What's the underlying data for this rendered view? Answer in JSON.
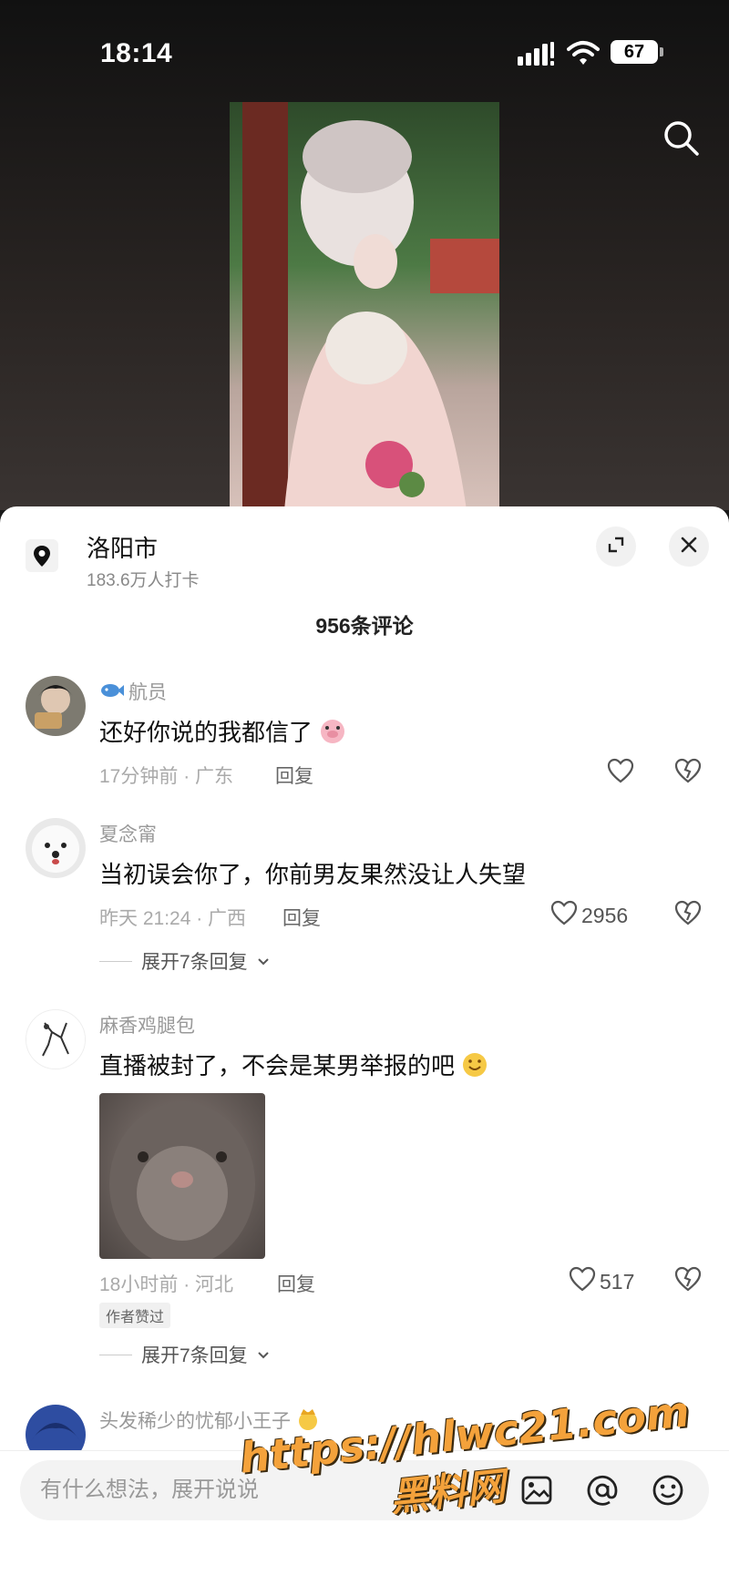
{
  "status_bar": {
    "time": "18:14",
    "battery": "67"
  },
  "video": {
    "search_icon": "search-icon"
  },
  "location": {
    "title": "洛阳市",
    "subtitle": "183.6万人打卡"
  },
  "comments_header": {
    "count_label": "956条评论"
  },
  "comments": [
    {
      "name": "航员",
      "text": "还好你说的我都信了",
      "time_location": "17分钟前 · 广东",
      "reply_label": "回复",
      "like_count": ""
    },
    {
      "name": "夏念甯",
      "text": "当初误会你了，你前男友果然没让人失望",
      "time_location": "昨天 21:24 · 广西",
      "reply_label": "回复",
      "like_count": "2956",
      "expand_label": "展开7条回复"
    },
    {
      "name": "麻香鸡腿包",
      "text": "直播被封了，不会是某男举报的吧",
      "time_location": "18小时前 · 河北",
      "reply_label": "回复",
      "like_count": "517",
      "badge": "作者赞过",
      "expand_label": "展开7条回复"
    },
    {
      "name": "头发稀少的忧郁小王子"
    }
  ],
  "input": {
    "placeholder": "有什么想法，展开说说"
  },
  "watermark": {
    "url": "https://hlwc21.com",
    "name": "黑料网"
  },
  "colors": {
    "like": "#555555",
    "watermark": "#f4a23b"
  }
}
